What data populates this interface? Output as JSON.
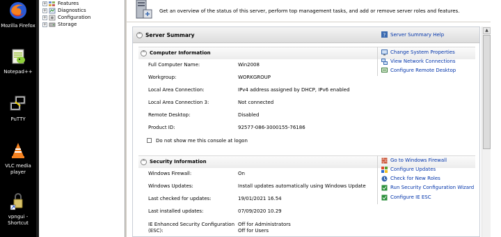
{
  "desktop": {
    "icons": [
      {
        "label": "Mozilla Firefox",
        "icon": "firefox-icon"
      },
      {
        "label": "Notepad++",
        "icon": "notepad-plus-plus-icon"
      },
      {
        "label": "PuTTY",
        "icon": "putty-icon"
      },
      {
        "label": "VLC media player",
        "icon": "vlc-icon"
      },
      {
        "label": "vpngui - Shortcut",
        "icon": "vpngui-shortcut-icon"
      }
    ]
  },
  "tree": {
    "items": [
      {
        "label": "Features",
        "expander": "+"
      },
      {
        "label": "Diagnostics",
        "expander": "+"
      },
      {
        "label": "Configuration",
        "expander": "+"
      },
      {
        "label": "Storage",
        "expander": "+"
      }
    ]
  },
  "banner": {
    "text": "Get an overview of the status of this server, perform top management tasks, and add or remove server roles and features."
  },
  "summary": {
    "title": "Server Summary",
    "help_link": "Server Summary Help",
    "computer": {
      "title": "Computer Information",
      "rows": [
        {
          "label": "Full Computer Name:",
          "value": "Win2008"
        },
        {
          "label": "Workgroup:",
          "value": "WORKGROUP"
        },
        {
          "label": "Local Area Connection:",
          "value": "IPv4 address assigned by DHCP, IPv6 enabled"
        },
        {
          "label": "Local Area Connection 3:",
          "value": "Not connected"
        },
        {
          "label": "Remote Desktop:",
          "value": "Disabled"
        },
        {
          "label": "Product ID:",
          "value": "92577-086-3000155-76186"
        }
      ],
      "checkbox_label": "Do not show me this console at logon",
      "tasks": [
        "Change System Properties",
        "View Network Connections",
        "Configure Remote Desktop"
      ]
    },
    "security": {
      "title": "Security Information",
      "rows": [
        {
          "label": "Windows Firewall:",
          "value": "On"
        },
        {
          "label": "Windows Updates:",
          "value": "Install updates automatically using Windows Update"
        },
        {
          "label": "Last checked for updates:",
          "value": "19/01/2021 16.54"
        },
        {
          "label": "Last installed updates:",
          "value": "07/09/2020 10.29"
        }
      ],
      "ie_label_line1": "IE Enhanced Security Configuration",
      "ie_label_line2": "(ESC):",
      "ie_value_line1": "Off for Administrators",
      "ie_value_line2": "Off for Users",
      "tasks": [
        "Go to Windows Firewall",
        "Configure Updates",
        "Check for New Roles",
        "Run Security Configuration Wizard",
        "Configure IE ESC"
      ]
    }
  },
  "colors": {
    "link": "#0033aa",
    "header_gradient_top": "#f4f4f4",
    "header_gradient_bottom": "#dcdcdc"
  }
}
